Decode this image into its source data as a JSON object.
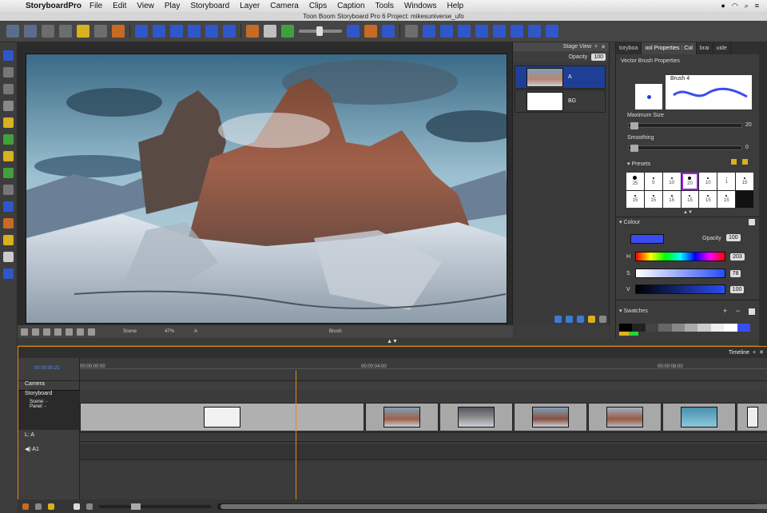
{
  "menubar": {
    "app_name": "StoryboardPro",
    "items": [
      "File",
      "Edit",
      "View",
      "Play",
      "Storyboard",
      "Layer",
      "Camera",
      "Clips",
      "Caption",
      "Tools",
      "Windows",
      "Help"
    ]
  },
  "window": {
    "title": "Toon Boom Storyboard Pro 6 Project: mikesuniverse_ufo"
  },
  "stage": {
    "view_title": "Stage View",
    "opacity_label": "Opacity",
    "opacity_value": "100",
    "bottom_scene": "Scene",
    "bottom_zoom": "47%",
    "bottom_a": "A",
    "bottom_brush": "Brush"
  },
  "layers": {
    "items": [
      {
        "name": "A"
      },
      {
        "name": "BG"
      }
    ]
  },
  "props": {
    "tabs": [
      "toryboa",
      "ool Properties : Col",
      "brai",
      "uide"
    ],
    "section_title": "Vector Brush Properties",
    "brush_name": "Brush 4",
    "max_size_label": "Maximum Size",
    "max_size_value": "20",
    "smoothing_label": "Smoothing",
    "smoothing_value": "0",
    "presets_label": "Presets",
    "presets": [
      "25",
      "5",
      "10",
      "20",
      "10",
      "1",
      "15",
      "15",
      "15",
      "15",
      "15",
      "15",
      "15",
      ""
    ],
    "colour_label": "Colour",
    "colour_opacity_label": "Opacity",
    "colour_opacity_value": "100",
    "h_label": "H",
    "h_value": "203",
    "s_label": "S",
    "s_value": "78",
    "v_label": "V",
    "v_value": "100",
    "swatches_label": "Swatches",
    "current_colour": "#3a4cf0"
  },
  "timeline": {
    "title": "Timeline",
    "current_time": "00:00:00:21",
    "ticks": [
      "00:00:00:00",
      "00:00:04:00",
      "00:00:08:00"
    ],
    "camera_label": "Camera",
    "storyboard_label": "Storyboard",
    "scene_label": "Scene: -",
    "panel_label": "Panel: -",
    "track_la": "L: A",
    "track_a1": "A1"
  }
}
